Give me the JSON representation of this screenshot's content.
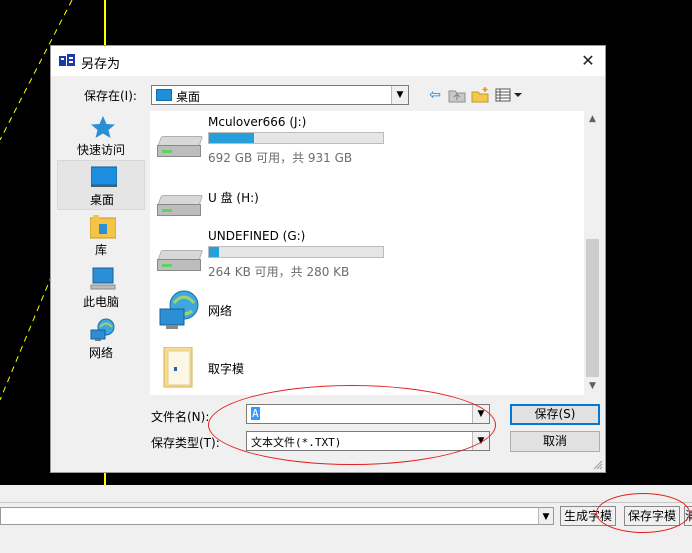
{
  "dialog": {
    "title": "另存为",
    "close": "✕",
    "save_in_label": "保存在(I):",
    "save_in_value": "桌面",
    "toolbar_icons": [
      "back-arrow-icon",
      "up-folder-icon",
      "new-folder-icon",
      "view-menu-icon"
    ]
  },
  "places": [
    {
      "label": "快速访问",
      "icon": "star-icon"
    },
    {
      "label": "桌面",
      "icon": "desktop-icon"
    },
    {
      "label": "库",
      "icon": "library-icon"
    },
    {
      "label": "此电脑",
      "icon": "computer-icon"
    },
    {
      "label": "网络",
      "icon": "network-icon"
    }
  ],
  "items": [
    {
      "name": "Mculover666 (J:)",
      "detail": "692 GB 可用，共 931 GB",
      "used_fraction": 0.257,
      "icon": "drive-icon"
    },
    {
      "name": "U 盘 (H:)",
      "icon": "drive-icon"
    },
    {
      "name": "UNDEFINED (G:)",
      "detail": "264 KB 可用，共 280 KB",
      "used_fraction": 0.057,
      "icon": "drive-icon"
    },
    {
      "name": "网络",
      "icon": "network-icon"
    },
    {
      "name": "取字模",
      "icon": "folder-icon"
    }
  ],
  "filename": {
    "label": "文件名(N):",
    "value": "A"
  },
  "filetype": {
    "label": "保存类型(T):",
    "value": "文本文件(*.TXT)"
  },
  "buttons": {
    "save": "保存(S)",
    "cancel": "取消"
  },
  "bottom_bar": {
    "generate": "生成字模",
    "save_font": "保存字模",
    "cut": "清"
  },
  "colors": {
    "accent": "#26a0da",
    "annotation": "#e0201e",
    "background_lines": "#ffff00"
  }
}
